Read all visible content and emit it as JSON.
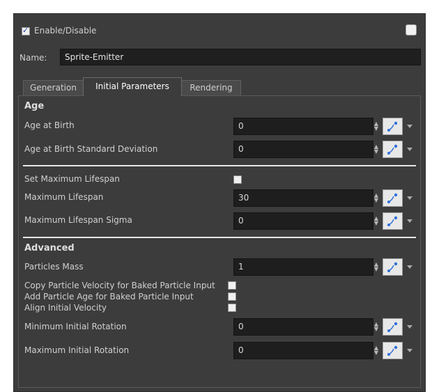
{
  "header": {
    "enable_label": "Enable/Disable",
    "enabled": true
  },
  "name": {
    "label": "Name:",
    "value": "Sprite-Emitter"
  },
  "tabs": [
    {
      "label": "Generation",
      "active": false
    },
    {
      "label": "Initial Parameters",
      "active": true
    },
    {
      "label": "Rendering",
      "active": false
    }
  ],
  "sections": {
    "age": "Age",
    "advanced": "Advanced"
  },
  "params": {
    "age_at_birth": {
      "label": "Age at Birth",
      "value": "0"
    },
    "age_at_birth_sd": {
      "label": "Age at Birth Standard Deviation",
      "value": "0"
    },
    "set_max_lifespan": {
      "label": "Set Maximum Lifespan",
      "checked": false
    },
    "max_lifespan": {
      "label": "Maximum Lifespan",
      "value": "30"
    },
    "max_lifespan_sigma": {
      "label": "Maximum Lifespan Sigma",
      "value": "0"
    },
    "particles_mass": {
      "label": "Particles Mass",
      "value": "1"
    },
    "copy_velocity": {
      "label": "Copy Particle Velocity for Baked Particle Input",
      "checked": false
    },
    "add_age": {
      "label": "Add Particle Age for Baked Particle Input",
      "checked": false
    },
    "align_velocity": {
      "label": "Align Initial Velocity",
      "checked": false
    },
    "min_rotation": {
      "label": "Minimum Initial Rotation",
      "value": "0"
    },
    "max_rotation": {
      "label": "Maximum Initial Rotation",
      "value": "0"
    }
  },
  "icons": {
    "spin": "spin-arrows-icon",
    "function_curve": "function-curve-icon",
    "dropdown": "dropdown-arrow-icon"
  },
  "colors": {
    "panel_bg": "#3c3c3c",
    "field_bg": "#1e1e1e",
    "accent_blue": "#2f6fd8"
  }
}
